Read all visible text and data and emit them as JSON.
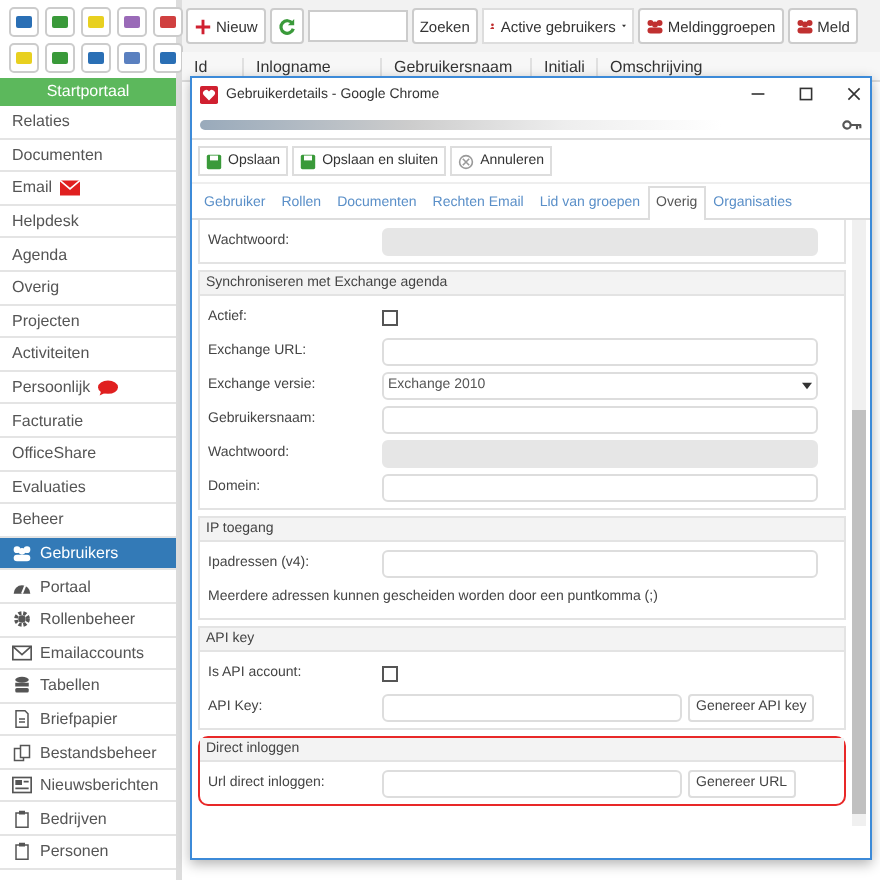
{
  "sidebar": {
    "header": "Startportaal",
    "items": [
      {
        "label": "Relaties",
        "kind": "plain",
        "selected": false
      },
      {
        "label": "Documenten",
        "kind": "plain",
        "selected": false
      },
      {
        "label": "Email",
        "kind": "mail-alert",
        "selected": false
      },
      {
        "label": "Helpdesk",
        "kind": "plain",
        "selected": false
      },
      {
        "label": "Agenda",
        "kind": "plain",
        "selected": false
      },
      {
        "label": "Overig",
        "kind": "plain",
        "selected": false
      },
      {
        "label": "Projecten",
        "kind": "plain",
        "selected": false
      },
      {
        "label": "Activiteiten",
        "kind": "plain",
        "selected": false
      },
      {
        "label": "Persoonlijk",
        "kind": "chat-alert",
        "selected": false
      },
      {
        "label": "Facturatie",
        "kind": "plain",
        "selected": false
      },
      {
        "label": "OfficeShare",
        "kind": "plain",
        "selected": false
      },
      {
        "label": "Evaluaties",
        "kind": "plain",
        "selected": false
      },
      {
        "label": "Beheer",
        "kind": "plain",
        "selected": false
      },
      {
        "label": "Gebruikers",
        "kind": "users",
        "selected": true
      },
      {
        "label": "Portaal",
        "kind": "dashboard",
        "selected": false
      },
      {
        "label": "Rollenbeheer",
        "kind": "gear",
        "selected": false
      },
      {
        "label": "Emailaccounts",
        "kind": "envelope",
        "selected": false
      },
      {
        "label": "Tabellen",
        "kind": "database",
        "selected": false
      },
      {
        "label": "Briefpapier",
        "kind": "document",
        "selected": false
      },
      {
        "label": "Bestandsbeheer",
        "kind": "files",
        "selected": false
      },
      {
        "label": "Nieuwsberichten",
        "kind": "news",
        "selected": false
      },
      {
        "label": "Bedrijven",
        "kind": "clipboard",
        "selected": false
      },
      {
        "label": "Personen",
        "kind": "clipboard",
        "selected": false
      }
    ]
  },
  "toolbar": {
    "new_button": "Nieuw",
    "search_button": "Zoeken",
    "filter": "Active gebruikers",
    "group_buttons": [
      "Meldinggroepen",
      "Meld"
    ]
  },
  "table": {
    "columns": [
      "Id",
      "Inlogname",
      "Gebruikersnaam",
      "Initiali",
      "Omschrijving"
    ]
  },
  "dialog": {
    "title": "Gebruikerdetails - Google Chrome",
    "buttons": [
      "Opslaan",
      "Opslaan en sluiten",
      "Annuleren"
    ],
    "tabs": [
      {
        "label": "Gebruiker",
        "selected": false
      },
      {
        "label": "Rollen",
        "selected": false
      },
      {
        "label": "Documenten",
        "selected": false
      },
      {
        "label": "Rechten Email",
        "selected": false
      },
      {
        "label": "Lid van groepen",
        "selected": false
      },
      {
        "label": "Overig",
        "selected": true
      },
      {
        "label": "Organisaties",
        "selected": false
      }
    ],
    "sections": [
      {
        "highlighted": false,
        "rows": [
          {
            "kind": "input",
            "label": "Wachtwoord:",
            "disabled": true
          }
        ]
      },
      {
        "header": "Synchroniseren met Exchange agenda",
        "highlighted": false,
        "rows": [
          {
            "kind": "checkbox",
            "label": "Actief:",
            "checked": false
          },
          {
            "kind": "input",
            "label": "Exchange URL:",
            "disabled": false
          },
          {
            "kind": "select",
            "label": "Exchange versie:",
            "value": "Exchange 2010"
          },
          {
            "kind": "input",
            "label": "Gebruikersnaam:",
            "disabled": false
          },
          {
            "kind": "input",
            "label": "Wachtwoord:",
            "disabled": true
          },
          {
            "kind": "input",
            "label": "Domein:",
            "disabled": false
          }
        ]
      },
      {
        "header": "IP toegang",
        "highlighted": false,
        "rows": [
          {
            "kind": "input",
            "label": "Ipadressen (v4):",
            "disabled": false
          },
          {
            "kind": "note",
            "label": "Meerdere adressen kunnen gescheiden worden door een puntkomma (;)"
          }
        ]
      },
      {
        "header": "API key",
        "highlighted": false,
        "rows": [
          {
            "kind": "checkbox",
            "label": "Is API account:",
            "checked": false
          },
          {
            "kind": "input-button",
            "label": "API Key:",
            "button": "Genereer API key"
          }
        ]
      },
      {
        "header": "Direct inloggen",
        "highlighted": true,
        "rows": [
          {
            "kind": "input-button",
            "label": "Url direct inloggen:",
            "button": "Genereer URL"
          }
        ]
      }
    ]
  }
}
